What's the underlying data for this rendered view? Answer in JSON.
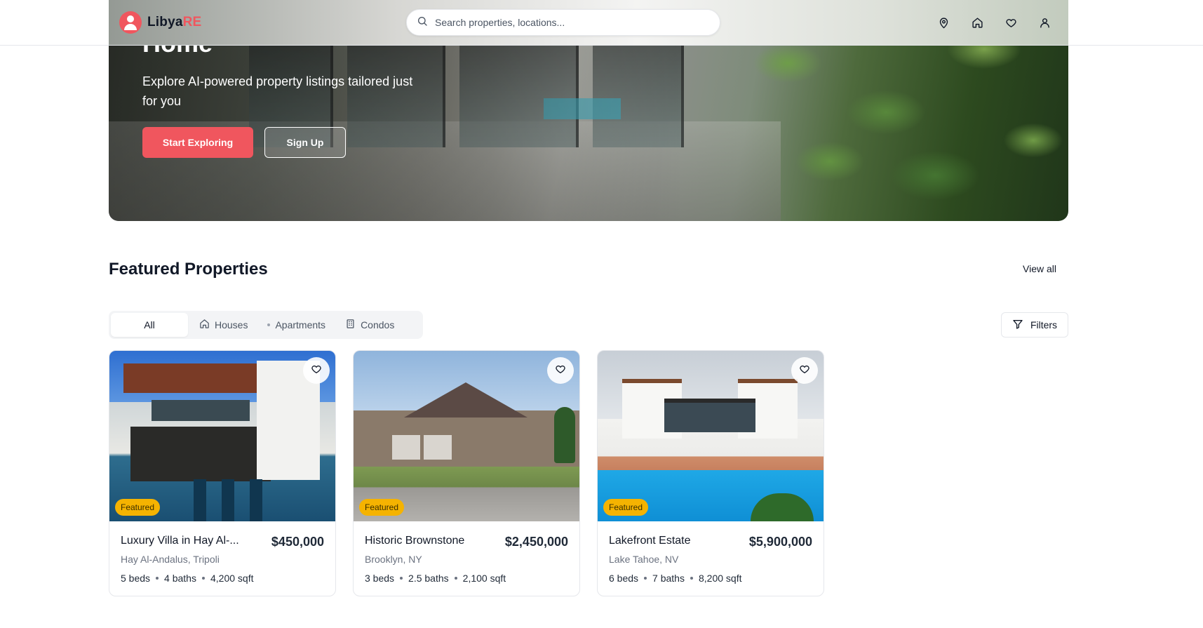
{
  "header": {
    "logo_main": "Libya",
    "logo_accent": "RE",
    "search_placeholder": "Search properties, locations...",
    "nav_icons": [
      "map-pin-icon",
      "home-icon",
      "heart-icon",
      "user-icon"
    ]
  },
  "hero": {
    "title": "Home",
    "subtitle": "Explore AI-powered property listings tailored just for you",
    "primary_button": "Start Exploring",
    "secondary_button": "Sign Up"
  },
  "featured": {
    "title": "Featured Properties",
    "view_all": "View all",
    "tabs": [
      {
        "label": "All",
        "icon": "",
        "active": true
      },
      {
        "label": "Houses",
        "icon": "home-icon",
        "active": false
      },
      {
        "label": "Apartments",
        "icon": "dot-icon",
        "active": false
      },
      {
        "label": "Condos",
        "icon": "building-icon",
        "active": false
      }
    ],
    "filters_label": "Filters"
  },
  "listings": [
    {
      "title": "Luxury Villa in Hay Al-...",
      "price": "$450,000",
      "location": "Hay Al-Andalus, Tripoli",
      "beds": "5 beds",
      "baths": "4 baths",
      "sqft": "4,200 sqft",
      "badge": "Featured"
    },
    {
      "title": "Historic Brownstone",
      "price": "$2,450,000",
      "location": "Brooklyn, NY",
      "beds": "3 beds",
      "baths": "2.5 baths",
      "sqft": "2,100 sqft",
      "badge": "Featured"
    },
    {
      "title": "Lakefront Estate",
      "price": "$5,900,000",
      "location": "Lake Tahoe, NV",
      "beds": "6 beds",
      "baths": "7 baths",
      "sqft": "8,200 sqft",
      "badge": "Featured"
    }
  ],
  "colors": {
    "brand": "#f0565e",
    "badge": "#f5b301",
    "text": "#111827",
    "muted": "#6b7280"
  }
}
